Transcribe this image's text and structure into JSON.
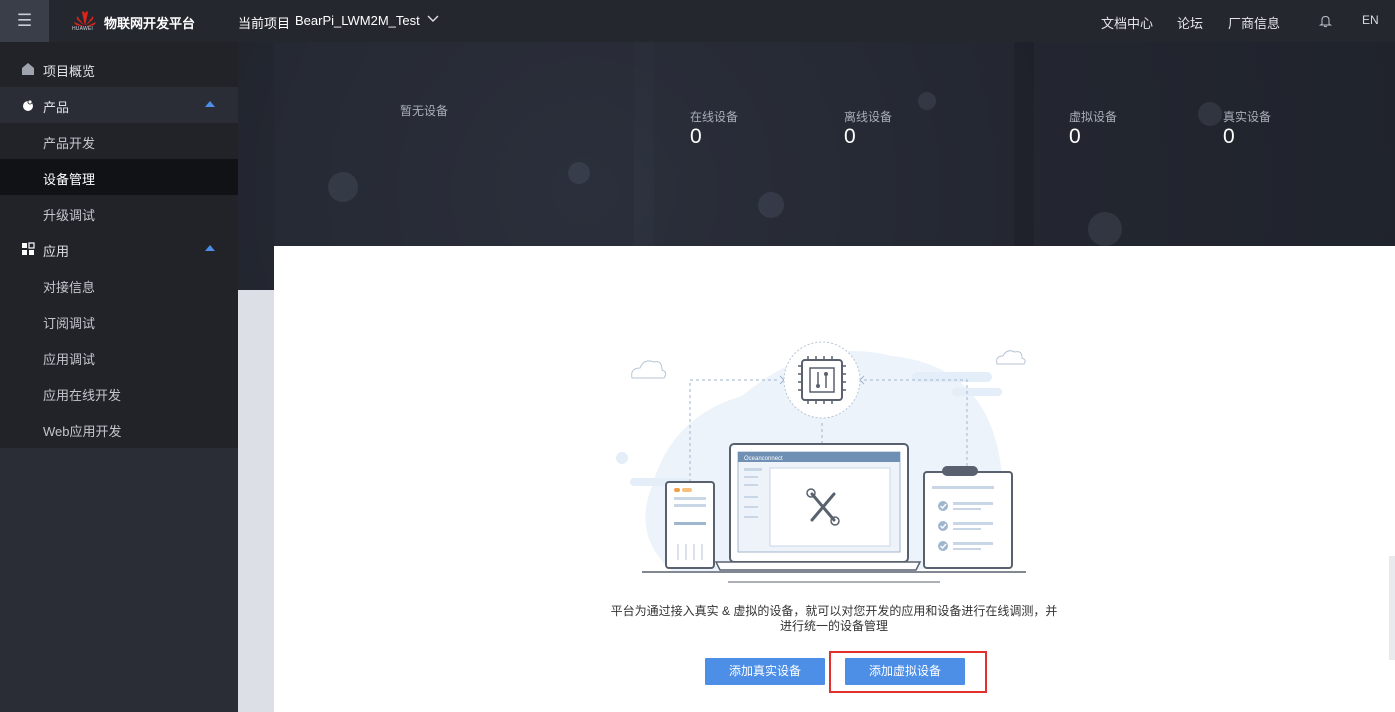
{
  "topbar": {
    "brand": "物联网开发平台",
    "logo_text": "HUAWEI",
    "project_label": "当前项目",
    "project_name": "BearPi_LWM2M_Test",
    "links": [
      "文档中心",
      "论坛",
      "厂商信息"
    ],
    "lang": "EN"
  },
  "sidebar": {
    "overview": "项目概览",
    "product_group": "产品",
    "product_items": [
      "产品开发",
      "设备管理",
      "升级调试"
    ],
    "app_group": "应用",
    "app_items": [
      "对接信息",
      "订阅调试",
      "应用调试",
      "应用在线开发",
      "Web应用开发"
    ],
    "active": "设备管理"
  },
  "hero": {
    "empty": "暂无设备",
    "online_label": "在线设备",
    "online_value": "0",
    "offline_label": "离线设备",
    "offline_value": "0",
    "virtual_label": "虚拟设备",
    "virtual_value": "0",
    "real_label": "真实设备",
    "real_value": "0"
  },
  "main": {
    "illustration_title": "Oceanconnect",
    "description_line1": "平台为通过接入真实 & 虚拟的设备，就可以对您开发的应用和设备进行在线调测，并",
    "description_line2": "进行统一的设备管理",
    "add_real_button": "添加真实设备",
    "add_virtual_button": "添加虚拟设备"
  },
  "colors": {
    "accent": "#4d8ee6",
    "highlight": "#e1312d",
    "topbar": "#25272f",
    "sidebar": "#2a2d35"
  }
}
